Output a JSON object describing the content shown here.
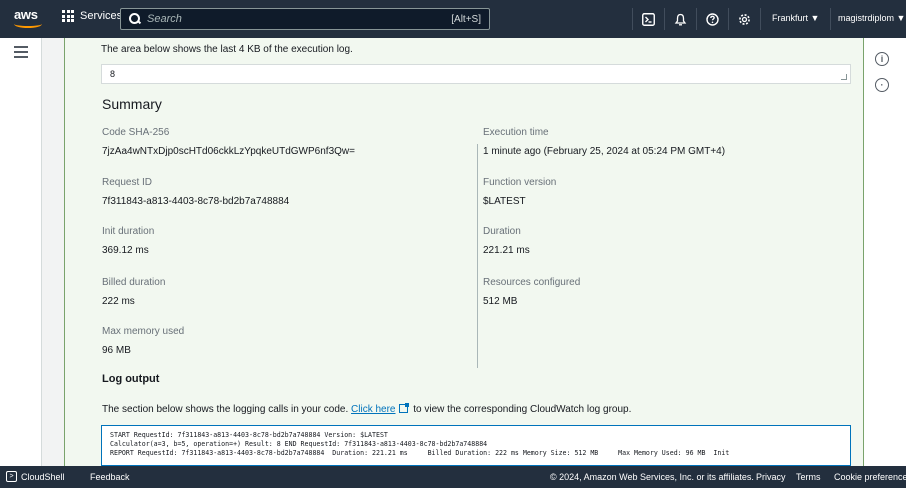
{
  "topnav": {
    "logo": "aws",
    "services_label": "Services",
    "search_placeholder": "Search",
    "search_shortcut": "[Alt+S]",
    "region": "Frankfurt ▼",
    "account": "magistrdiplom ▼"
  },
  "execution_log": {
    "intro": "The area below shows the last 4 KB of the execution log.",
    "value": "8"
  },
  "summary": {
    "heading": "Summary",
    "left": [
      {
        "label": "Code SHA-256",
        "value": "7jzAa4wNTxDjp0scHTd06ckkLzYpqkeUTdGWP6nf3Qw="
      },
      {
        "label": "Request ID",
        "value": "7f311843-a813-4403-8c78-bd2b7a748884"
      },
      {
        "label": "Init duration",
        "value": "369.12 ms"
      },
      {
        "label": "Billed duration",
        "value": "222 ms"
      },
      {
        "label": "Max memory used",
        "value": "96 MB"
      }
    ],
    "right": [
      {
        "label": "Execution time",
        "value": "1 minute ago (February 25, 2024 at 05:24 PM GMT+4)"
      },
      {
        "label": "Function version",
        "value": "$LATEST"
      },
      {
        "label": "Duration",
        "value": "221.21 ms"
      },
      {
        "label": "Resources configured",
        "value": "512 MB"
      }
    ]
  },
  "log_output": {
    "heading": "Log output",
    "desc_before": "The section below shows the logging calls in your code. ",
    "link": "Click here",
    "desc_after": " to view the corresponding CloudWatch log group.",
    "lines": [
      "START RequestId: 7f311843-a813-4403-8c78-bd2b7a748884 Version: $LATEST",
      "Calculator(a=3, b=5, operation=+) Result: 8 END RequestId: 7f311843-a813-4403-8c78-bd2b7a748884",
      "REPORT RequestId: 7f311843-a813-4403-8c78-bd2b7a748884  Duration: 221.21 ms     Billed Duration: 222 ms Memory Size: 512 MB     Max Memory Used: 96 MB  Init"
    ]
  },
  "footer": {
    "cloudshell": "CloudShell",
    "feedback": "Feedback",
    "copyright": "© 2024, Amazon Web Services, Inc. or its affiliates.",
    "privacy": "Privacy",
    "terms": "Terms",
    "cookies": "Cookie preferences"
  }
}
